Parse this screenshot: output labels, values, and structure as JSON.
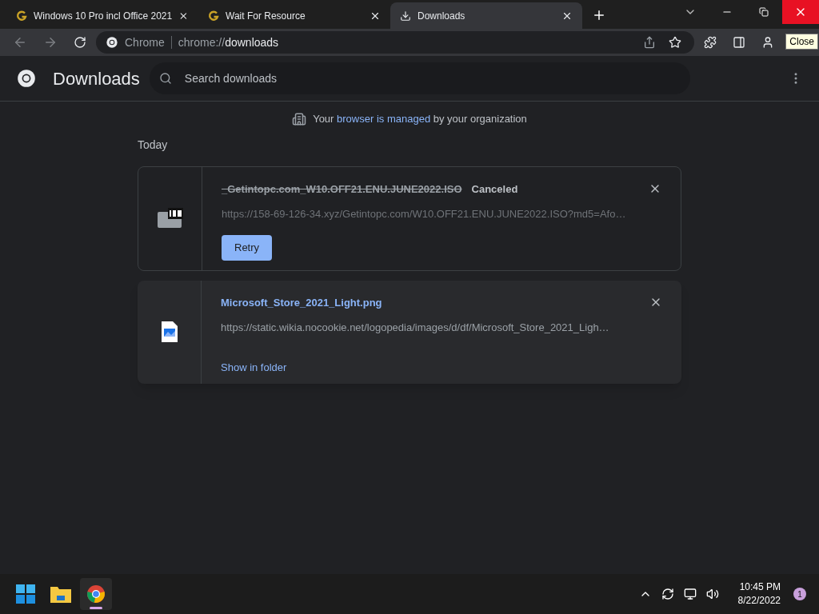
{
  "tabs": [
    {
      "kind": "site",
      "title": "Windows 10 Pro incl Office 2021",
      "selected": false
    },
    {
      "kind": "site",
      "title": "Wait For Resource",
      "selected": false
    },
    {
      "kind": "download",
      "title": "Downloads",
      "selected": true
    }
  ],
  "address": {
    "origin_label": "Chrome",
    "scheme": "chrome://",
    "path": "downloads"
  },
  "tooltip": "Close",
  "header": {
    "title": "Downloads",
    "search_placeholder": "Search downloads"
  },
  "managed_notice": {
    "before": "Your",
    "link": "browser is managed",
    "after": "by your organization"
  },
  "section": "Today",
  "downloads": [
    {
      "kind": "iso",
      "filename": "_Getintopc.com_W10.OFF21.ENU.JUNE2022.ISO",
      "canceled": true,
      "status": "Canceled",
      "url": "https://158-69-126-34.xyz/Getintopc.com/W10.OFF21.ENU.JUNE2022.ISO?md5=Afo…",
      "action": {
        "kind": "button",
        "label": "Retry"
      }
    },
    {
      "kind": "image",
      "filename": "Microsoft_Store_2021_Light.png",
      "canceled": false,
      "url": "https://static.wikia.nocookie.net/logopedia/images/d/df/Microsoft_Store_2021_Ligh…",
      "action": {
        "kind": "link",
        "label": "Show in folder"
      }
    }
  ],
  "taskbar": {
    "apps": [
      {
        "kind": "start",
        "selected": false
      },
      {
        "kind": "files",
        "selected": false
      },
      {
        "kind": "chrome",
        "selected": true
      }
    ],
    "time": "10:45 PM",
    "date": "8/22/2022",
    "notifications": "1"
  }
}
